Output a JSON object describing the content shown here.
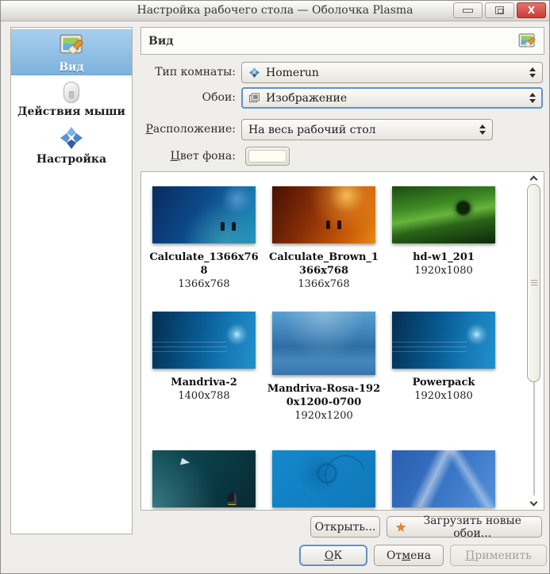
{
  "window": {
    "title": "Настройка рабочего стола — Оболочка Plasma",
    "close_glyph": "X"
  },
  "sidebar": {
    "items": [
      {
        "label": "Вид",
        "selected": true
      },
      {
        "label": "Действия мыши",
        "selected": false
      },
      {
        "label": "Настройка",
        "selected": false
      }
    ]
  },
  "header": {
    "title": "Вид"
  },
  "form": {
    "room_type": {
      "label": "Тип комнаты:",
      "value": "Homerun"
    },
    "wallpaper_type": {
      "label": "Обои:",
      "value": "Изображение"
    },
    "positioning": {
      "accel": "Р",
      "rest": "асположение:",
      "value": "На весь рабочий стол"
    },
    "bg_color": {
      "accel": "Ц",
      "rest": "вет фона:"
    }
  },
  "wallpapers": {
    "items": [
      {
        "name": "Calculate_1366x768",
        "resolution": "1366x768"
      },
      {
        "name": "Calculate_Brown_1366x768",
        "resolution": "1366x768"
      },
      {
        "name": "hd-w1_201",
        "resolution": "1920x1080"
      },
      {
        "name": "Mandriva-2",
        "resolution": "1400x788"
      },
      {
        "name": "Mandriva-Rosa-1920x1200-0700",
        "resolution": "1920x1200"
      },
      {
        "name": "Powerpack",
        "resolution": "1920x1080"
      }
    ]
  },
  "actions": {
    "open": "Открыть...",
    "get_new": "Загрузить новые обои..."
  },
  "dialog_buttons": {
    "ok": {
      "accel": "О",
      "rest": "К"
    },
    "cancel": {
      "pre": "От",
      "accel": "м",
      "rest": "ена"
    },
    "apply": {
      "accel": "П",
      "rest": "рименить"
    }
  },
  "colors": {
    "selection_blue": "#7db2dd",
    "focus_blue": "#5d92cc",
    "close_red": "#c63c35",
    "star_orange": "#e08a28"
  }
}
